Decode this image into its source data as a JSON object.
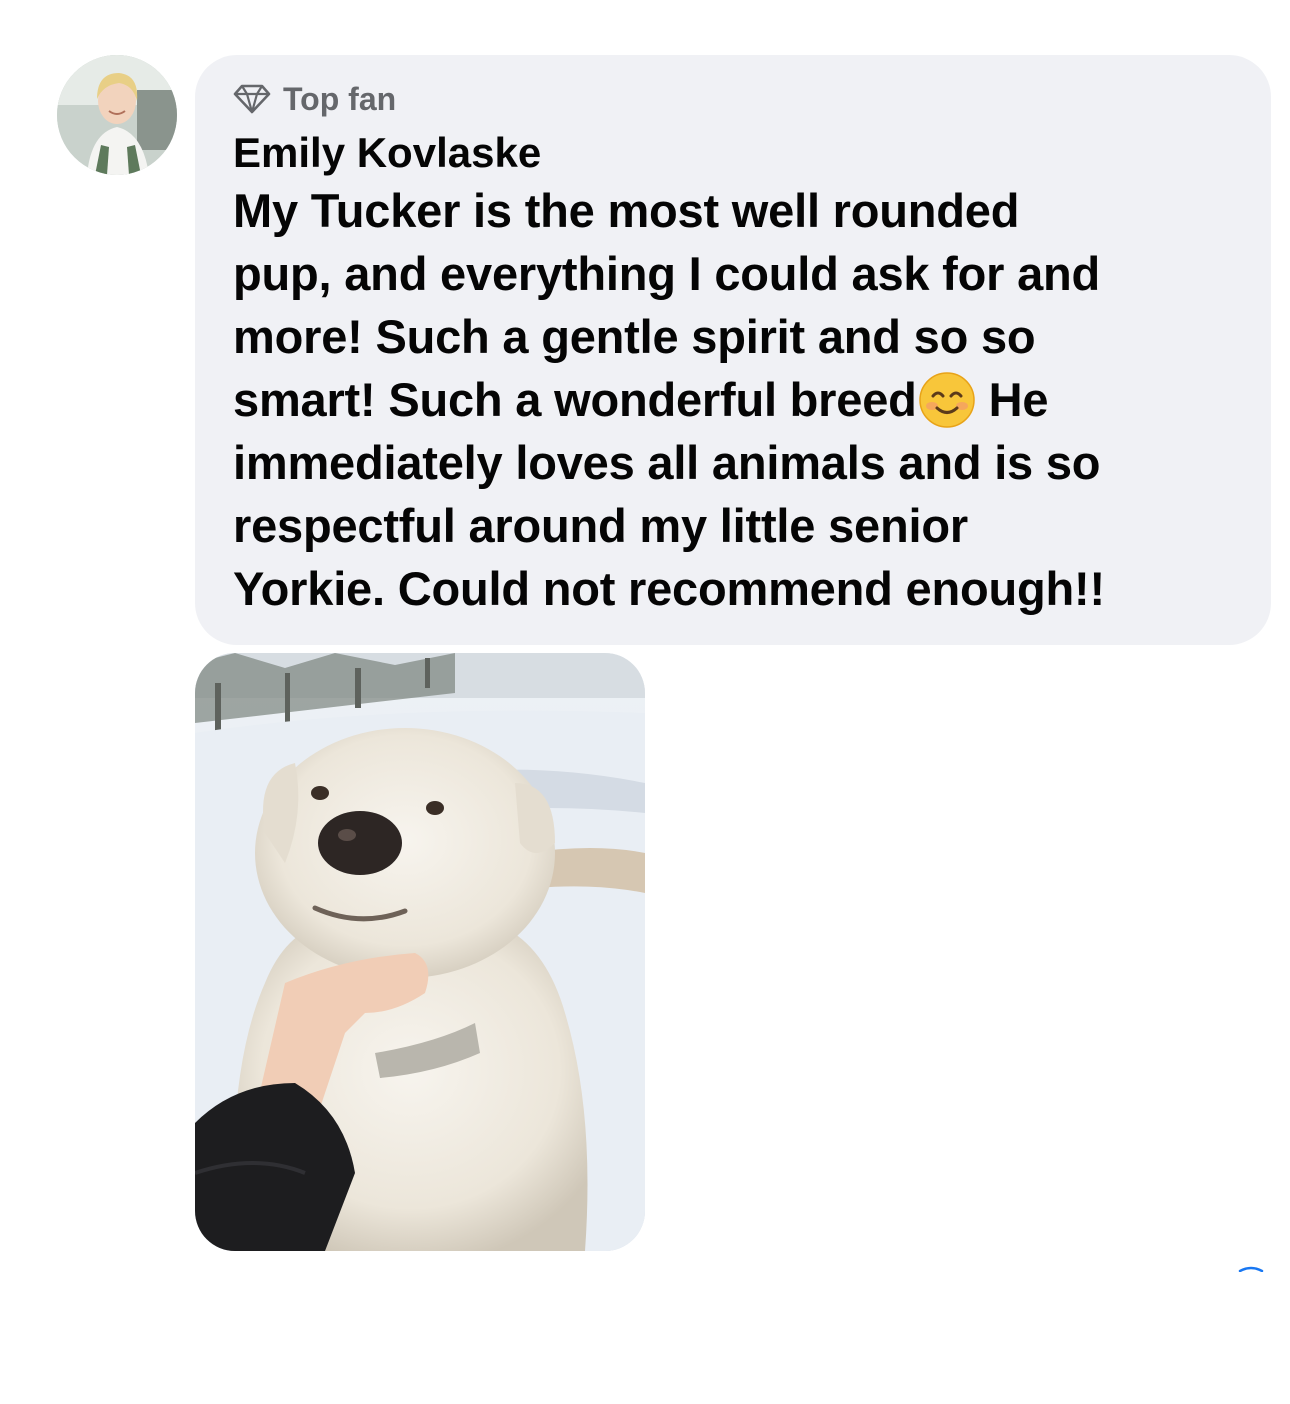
{
  "comment": {
    "badge": "Top fan",
    "author": "Emily Kovlaske",
    "lines": [
      "My Tucker is the most well rounded",
      "pup, and everything I could ask for and",
      "more! Such a gentle spirit and so so",
      "smart! Such a wonderful breed",
      "He",
      "immediately loves all animals and is so",
      "respectful around my little senior",
      "Yorkie. Could not recommend enough!!"
    ],
    "emoji": "smiling-face-with-smiling-eyes"
  },
  "colors": {
    "bubble": "#f0f1f5",
    "text": "#050505",
    "secondary_text": "#65676b"
  },
  "icons": {
    "badge_icon": "diamond-icon",
    "corner_icon": "partial-blue-arc-icon"
  }
}
